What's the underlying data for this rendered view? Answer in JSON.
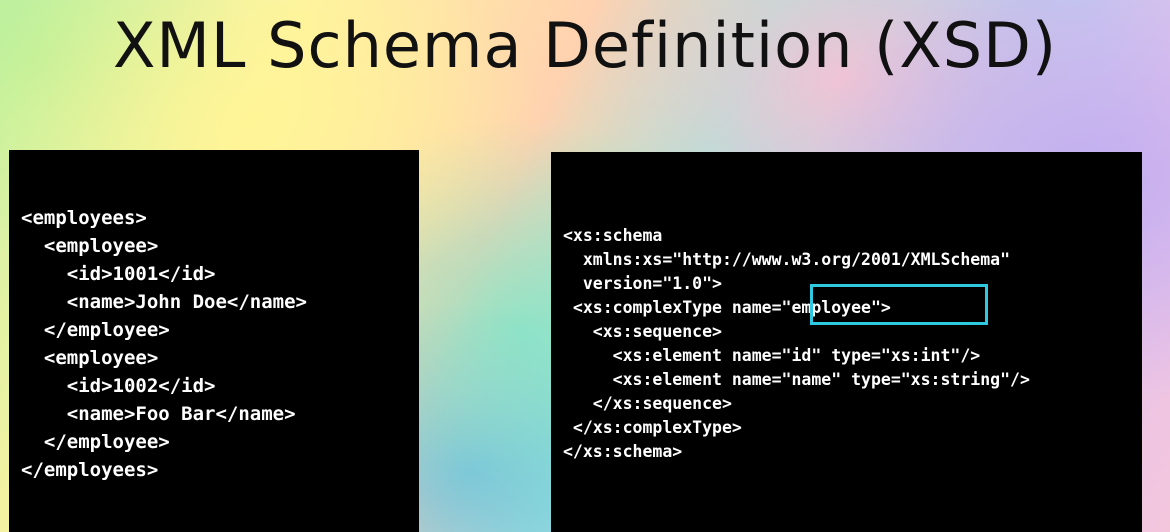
{
  "title": "XML Schema Definition (XSD)",
  "xml_example": {
    "lines": [
      "<employees>",
      "  <employee>",
      "    <id>1001</id>",
      "    <name>John Doe</name>",
      "  </employee>",
      "  <employee>",
      "    <id>1002</id>",
      "    <name>Foo Bar</name>",
      "  </employee>",
      "</employees>"
    ]
  },
  "xsd_example": {
    "lines": [
      "<xs:schema",
      "  xmlns:xs=\"http://www.w3.org/2001/XMLSchema\"",
      "  version=\"1.0\">",
      " <xs:complexType name=\"employee\">",
      "   <xs:sequence>",
      "     <xs:element name=\"id\" type=\"xs:int\"/>",
      "     <xs:element name=\"name\" type=\"xs:string\"/>",
      "   </xs:sequence>",
      " </xs:complexType>",
      "</xs:schema>"
    ],
    "highlight_color": "#2ec8e0"
  }
}
